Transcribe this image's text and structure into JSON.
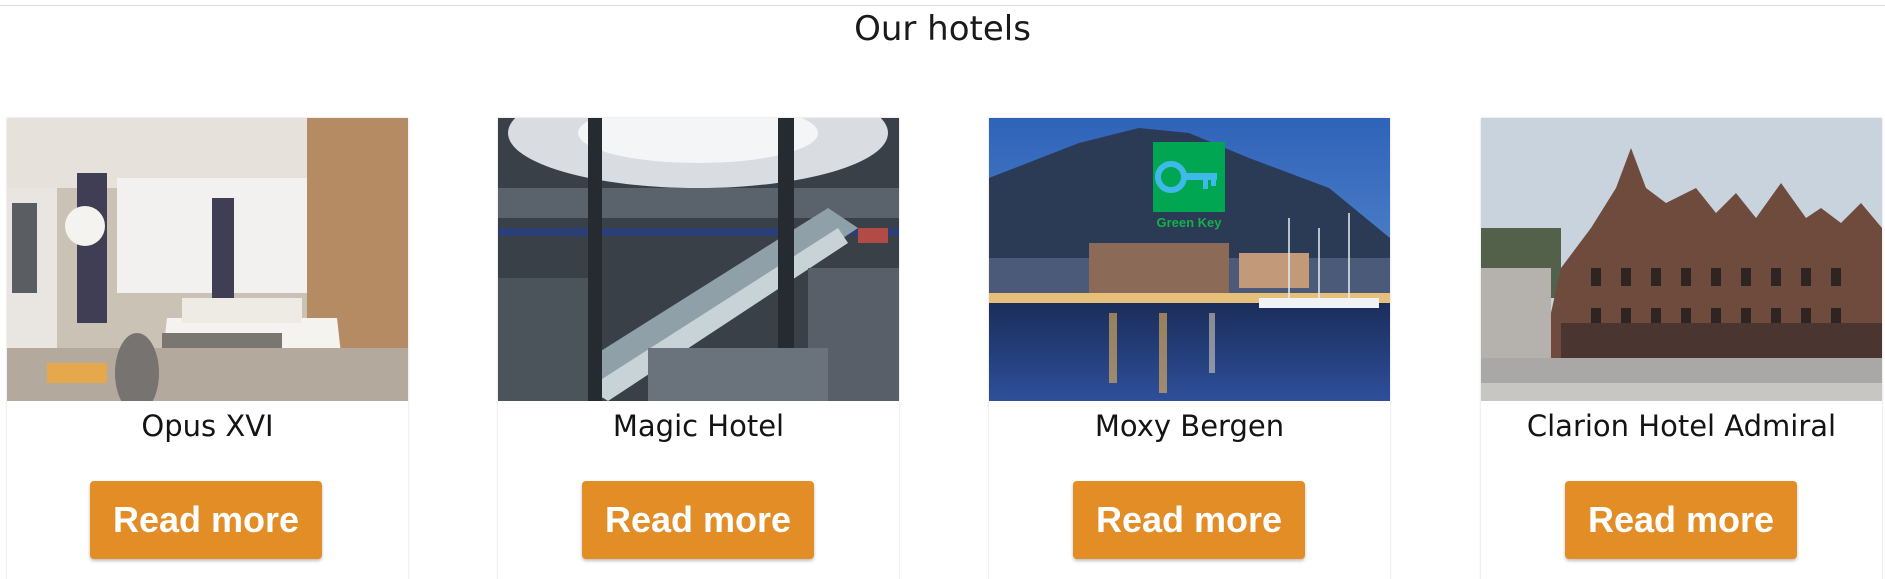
{
  "section": {
    "title": "Our hotels"
  },
  "hotels": [
    {
      "name": "Opus XVI",
      "button_label": "Read more",
      "image": "hotel-room-photo"
    },
    {
      "name": "Magic Hotel",
      "button_label": "Read more",
      "image": "shopping-mall-escalator-photo"
    },
    {
      "name": "Moxy Bergen",
      "button_label": "Read more",
      "image": "harbor-night-photo",
      "badge": "Green Key"
    },
    {
      "name": "Clarion Hotel Admiral",
      "button_label": "Read more",
      "image": "historic-building-photo"
    }
  ],
  "colors": {
    "button": "#e38d26",
    "badge": "#00a651"
  }
}
